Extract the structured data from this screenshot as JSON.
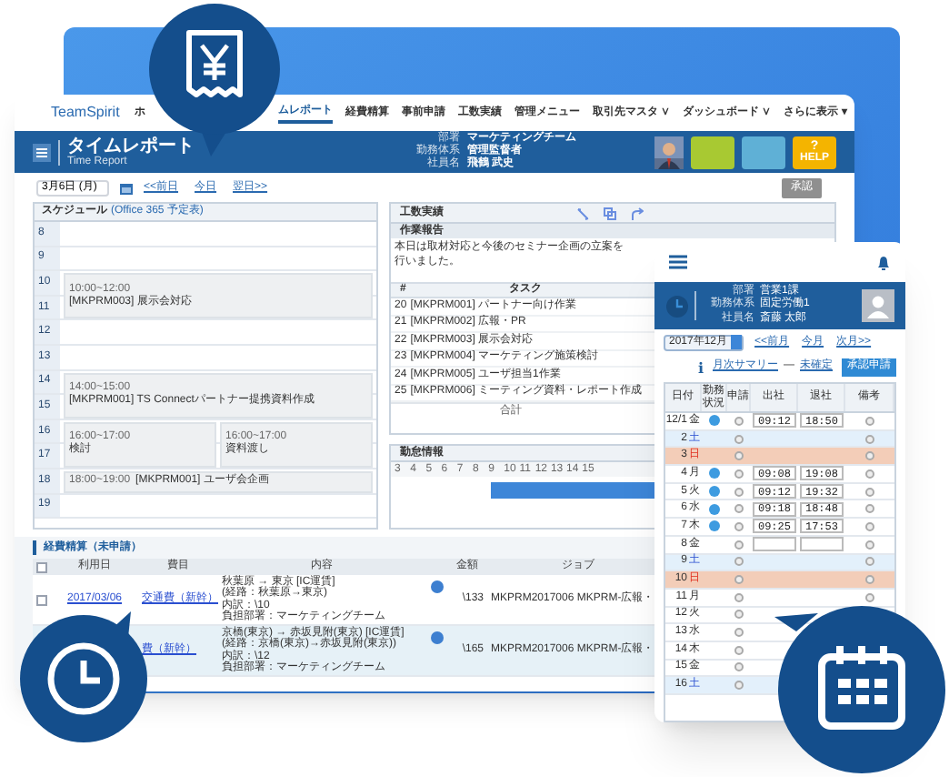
{
  "nav": {
    "brand": "TeamSpirit",
    "items": [
      {
        "label": "ホ",
        "selected": false
      },
      {
        "label": "ムレポート",
        "selected": true
      },
      {
        "label": "経費精算",
        "selected": false
      },
      {
        "label": "事前申請",
        "selected": false
      },
      {
        "label": "工数実績",
        "selected": false
      },
      {
        "label": "管理メニュー",
        "selected": false
      },
      {
        "label": "取引先マスタ ∨",
        "selected": false
      },
      {
        "label": "ダッシュボード ∨",
        "selected": false
      },
      {
        "label": "さらに表示 ▾",
        "selected": false
      }
    ]
  },
  "header": {
    "title": "タイムレポート",
    "subtitle": "Time Report",
    "fields": [
      {
        "label": "部署",
        "value": "マーケティングチーム"
      },
      {
        "label": "勤務体系",
        "value": "管理監督者"
      },
      {
        "label": "社員名",
        "value": "飛鶴 武史"
      }
    ],
    "help_icon": "?",
    "help_label": "HELP"
  },
  "toolbar": {
    "date": "3月6日 (月)",
    "links": [
      "<<前日",
      "今日",
      "翌日>>"
    ],
    "button": "承認"
  },
  "schedule": {
    "title": "スケジュール",
    "source": "(Office 365 予定表)",
    "hours": [
      {
        "label": "8"
      },
      {
        "label": "9"
      },
      {
        "label": "10",
        "events": [
          {
            "kind": "double",
            "time": "10:00~12:00",
            "title": "[MKPRM003] 展示会対応"
          }
        ]
      },
      {
        "label": "11"
      },
      {
        "label": "12"
      },
      {
        "label": "13"
      },
      {
        "label": "14",
        "events": [
          {
            "kind": "double",
            "time": "14:00~15:00",
            "title": "[MKPRM001] TS Connectパートナー提携資料作成"
          }
        ]
      },
      {
        "label": "15"
      },
      {
        "label": "16",
        "events": [
          {
            "kind": "double",
            "time": "16:00~17:00",
            "title": "検討"
          },
          {
            "kind": "double",
            "time": "16:00~17:00",
            "title": "資料渡し"
          }
        ]
      },
      {
        "label": "17"
      },
      {
        "label": "18",
        "events": [
          {
            "kind": "single",
            "time": "18:00~19:00",
            "title": "[MKPRM001] ユーザ会企画"
          }
        ]
      },
      {
        "label": "19"
      }
    ]
  },
  "work": {
    "title": "工数実績",
    "report_title": "作業報告",
    "report": "本日は取材対応と今後のセミナー企画の立案を行いました。",
    "columns": [
      "#",
      "タスク"
    ],
    "tasks": [
      {
        "no": "20",
        "task": "[MKPRM001] パートナー向け作業"
      },
      {
        "no": "21",
        "task": "[MKPRM002] 広報・PR"
      },
      {
        "no": "22",
        "task": "[MKPRM003] 展示会対応"
      },
      {
        "no": "23",
        "task": "[MKPRM004] マーケティング施策検討"
      },
      {
        "no": "24",
        "task": "[MKPRM005] ユーザ担当1作業"
      },
      {
        "no": "25",
        "task": "[MKPRM006] ミーティング資料・レポート作成"
      }
    ],
    "total": "合計",
    "attendance_title": "勤怠情報",
    "attendance_hours": [
      "3",
      "4",
      "5",
      "6",
      "7",
      "8",
      "9",
      "10",
      "11",
      "12",
      "13",
      "14",
      "15"
    ]
  },
  "expenses": {
    "title": "経費精算（未申請）",
    "select_all_checked": false,
    "columns": [
      "利用日",
      "費目",
      "内容",
      "金額",
      "ジョブ"
    ],
    "rows": [
      {
        "date": "2017/03/06",
        "type": "交通費（新幹）",
        "lines": [
          "秋葉原 → 東京 [IC運賃]",
          "(経路：秋葉原→東京)",
          "内訳：\\10",
          "負担部署：マーケティングチーム"
        ],
        "amount": "\\133",
        "job": "MKPRM2017006 MKPRM-広報・",
        "checked": false,
        "selected": false
      },
      {
        "type": "費（新幹）",
        "lines": [
          "京橋(東京) → 赤坂見附(東京) [IC運賃]",
          "(経路：京橋(東京)→赤坂見附(東京))",
          "内訳：\\12",
          "負担部署：マーケティングチーム"
        ],
        "amount": "\\165",
        "job": "MKPRM2017006 MKPRM-広報・",
        "selected": true
      }
    ]
  },
  "mobile": {
    "fields": [
      {
        "label": "部署",
        "value": "営業1課"
      },
      {
        "label": "勤務体系",
        "value": "固定労働1"
      },
      {
        "label": "社員名",
        "value": "斎藤 太郎"
      }
    ],
    "month": "2017年12月",
    "links": [
      "<<前月",
      "今月",
      "次月>>"
    ],
    "info_icon": "i",
    "summary_link": "月次サマリー",
    "dash": "—",
    "status_link": "未確定",
    "submit": "承認申請",
    "columns": [
      "日付",
      "勤務状況",
      "申請",
      "出社",
      "退社",
      "備考"
    ],
    "rows": [
      {
        "date": "12/1",
        "dow": "金",
        "kind": "weekday",
        "worked": true,
        "entry": true,
        "in": "09:12",
        "out": "18:50"
      },
      {
        "date": "2",
        "dow": "土",
        "kind": "saturday",
        "worked": false,
        "entry": false
      },
      {
        "date": "3",
        "dow": "日",
        "kind": "holiday",
        "worked": false,
        "entry": false
      },
      {
        "date": "4",
        "dow": "月",
        "kind": "weekday",
        "worked": true,
        "entry": true,
        "in": "09:08",
        "out": "19:08"
      },
      {
        "date": "5",
        "dow": "火",
        "kind": "weekday",
        "worked": true,
        "entry": true,
        "in": "09:12",
        "out": "19:32"
      },
      {
        "date": "6",
        "dow": "水",
        "kind": "weekday",
        "worked": true,
        "entry": true,
        "in": "09:18",
        "out": "18:48"
      },
      {
        "date": "7",
        "dow": "木",
        "kind": "weekday",
        "worked": true,
        "entry": true,
        "in": "09:25",
        "out": "17:53"
      },
      {
        "date": "8",
        "dow": "金",
        "kind": "weekday",
        "worked": false,
        "entry": true
      },
      {
        "date": "9",
        "dow": "土",
        "kind": "saturday",
        "worked": false,
        "entry": false
      },
      {
        "date": "10",
        "dow": "日",
        "kind": "holiday",
        "worked": false,
        "entry": false
      },
      {
        "date": "11",
        "dow": "月",
        "kind": "weekday",
        "worked": false,
        "entry": false
      },
      {
        "date": "12",
        "dow": "火",
        "kind": "weekday",
        "worked": false,
        "entry": false
      },
      {
        "date": "13",
        "dow": "水",
        "kind": "weekday",
        "worked": false,
        "entry": false
      },
      {
        "date": "14",
        "dow": "木",
        "kind": "weekday",
        "worked": false,
        "entry": false
      },
      {
        "date": "15",
        "dow": "金",
        "kind": "weekday",
        "worked": false,
        "entry": false
      },
      {
        "date": "16",
        "dow": "土",
        "kind": "saturday",
        "worked": false,
        "entry": false
      }
    ]
  }
}
